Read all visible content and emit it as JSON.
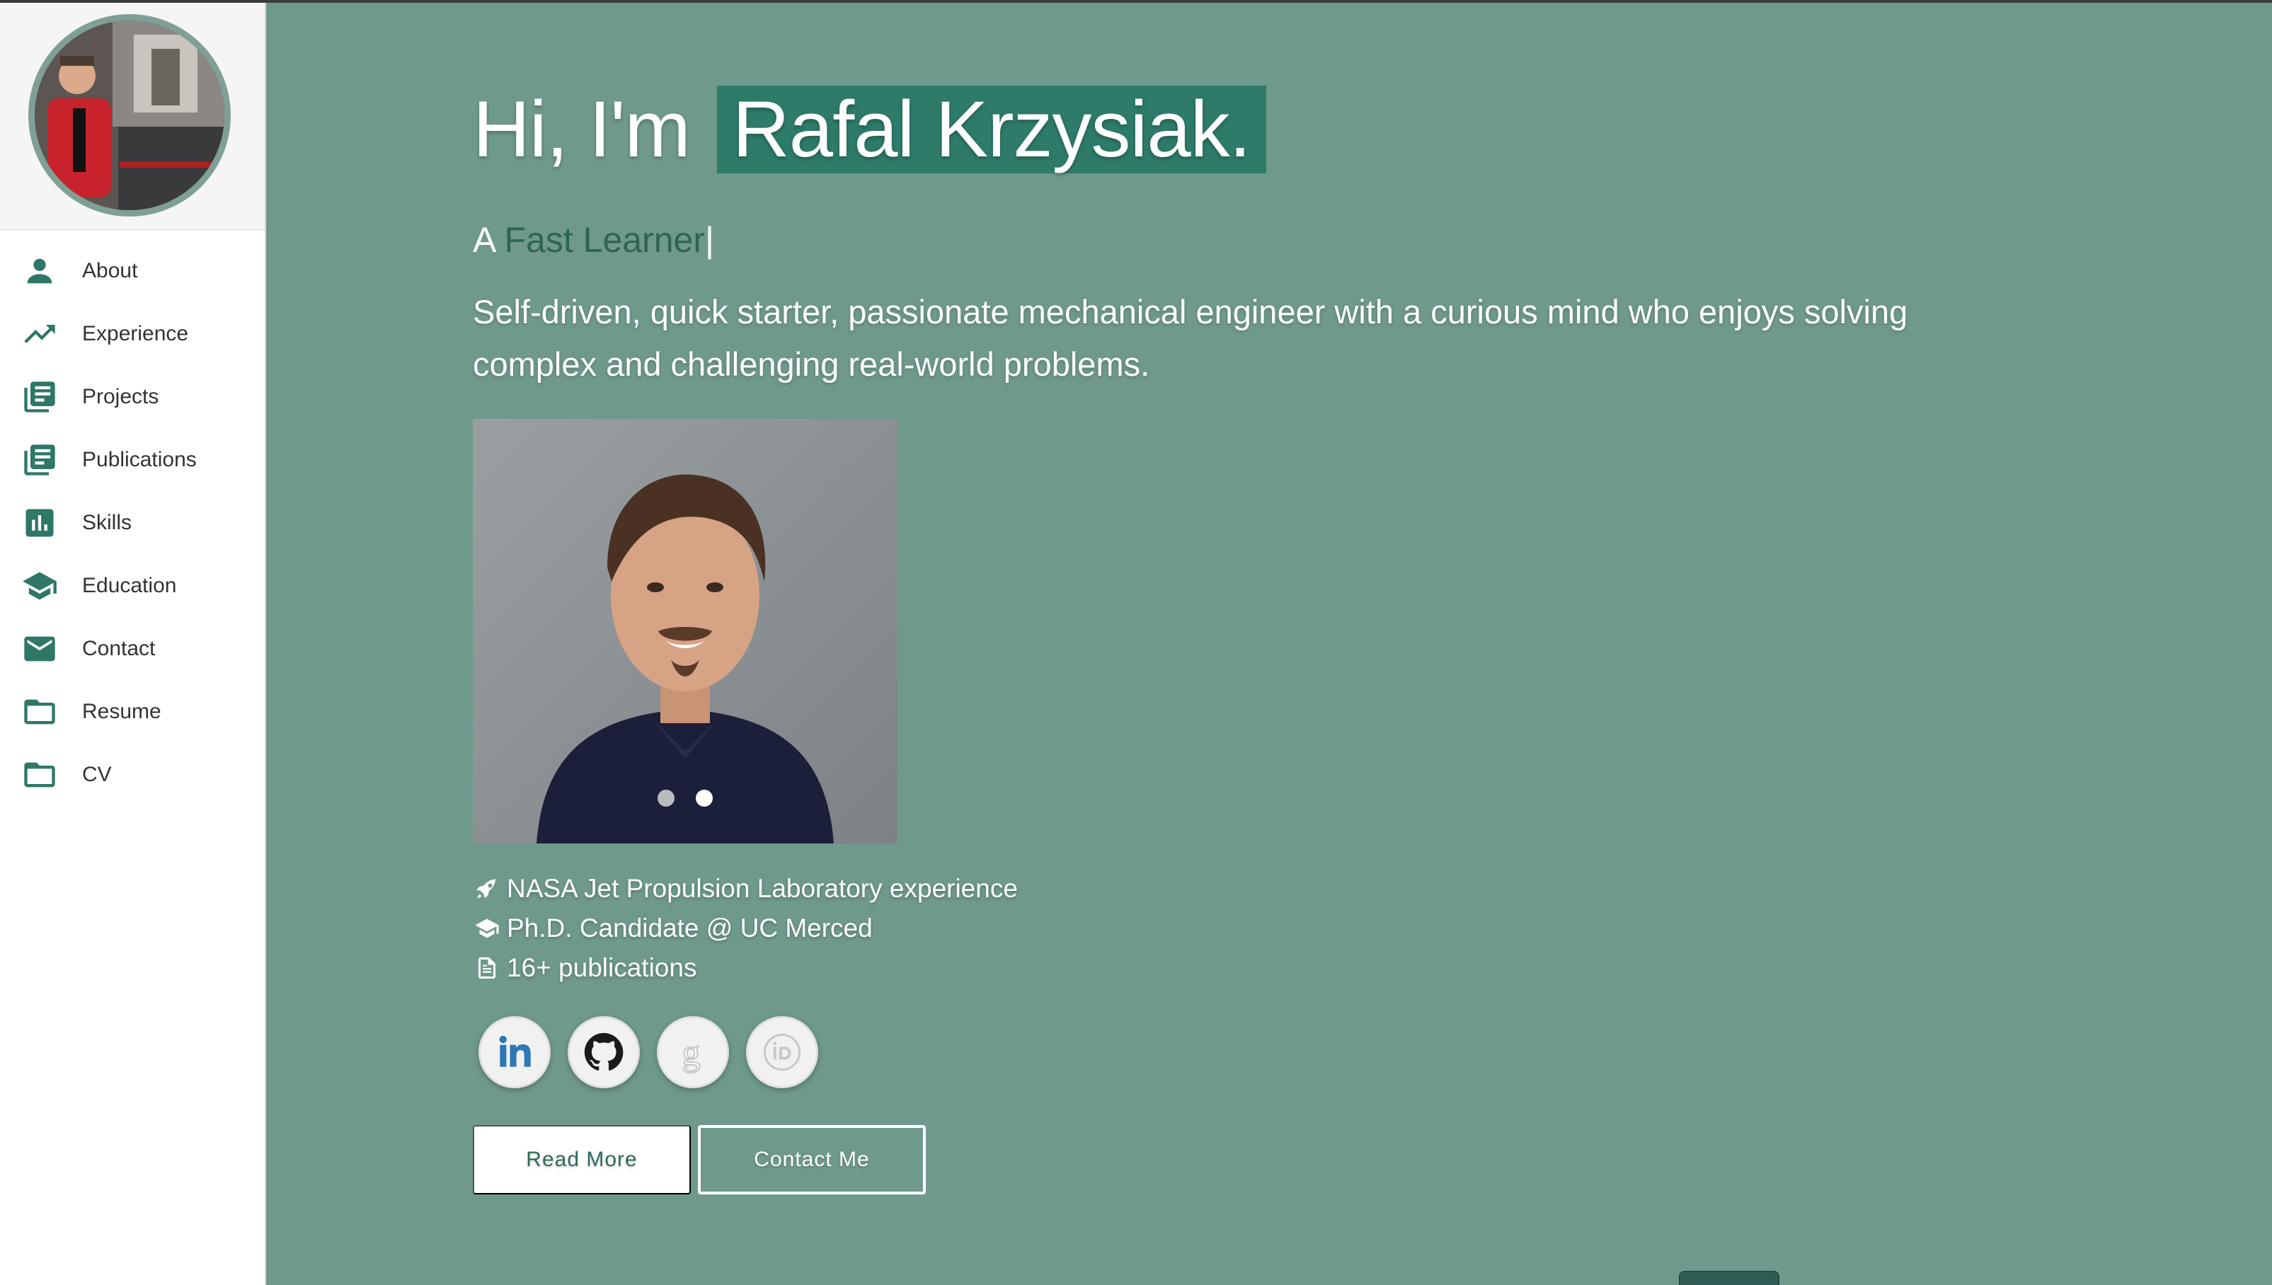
{
  "sidebar": {
    "items": [
      {
        "label": "About",
        "icon": "person-icon"
      },
      {
        "label": "Experience",
        "icon": "trending-up-icon"
      },
      {
        "label": "Projects",
        "icon": "library-books-icon"
      },
      {
        "label": "Publications",
        "icon": "library-books-icon"
      },
      {
        "label": "Skills",
        "icon": "bar-chart-icon"
      },
      {
        "label": "Education",
        "icon": "graduation-cap-icon"
      },
      {
        "label": "Contact",
        "icon": "mail-icon"
      },
      {
        "label": "Resume",
        "icon": "folder-icon"
      },
      {
        "label": "CV",
        "icon": "folder-icon"
      }
    ]
  },
  "hero": {
    "greeting": "Hi, I'm",
    "name": "Rafal Krzysiak.",
    "typed_prefix": "A",
    "typed_word": "Fast Learner",
    "typed_cursor": "|",
    "description": "Self-driven, quick starter, passionate mechanical engineer with a curious mind who enjoys solving complex and challenging real-world problems."
  },
  "carousel": {
    "slide_count": 2,
    "active_index": 1
  },
  "facts": [
    {
      "icon": "rocket-icon",
      "text": "NASA Jet Propulsion Laboratory experience"
    },
    {
      "icon": "graduation-cap-icon",
      "text": "Ph.D. Candidate @ UC Merced"
    },
    {
      "icon": "file-text-icon",
      "text": "16+ publications"
    }
  ],
  "socials": [
    {
      "name": "linkedin-icon"
    },
    {
      "name": "github-icon"
    },
    {
      "name": "google-scholar-icon"
    },
    {
      "name": "orcid-icon"
    }
  ],
  "buttons": {
    "read_more": "Read More",
    "contact_me": "Contact Me"
  },
  "colors": {
    "background": "#6f998c",
    "accent": "#2e7b6a",
    "icon": "#2f7767"
  }
}
